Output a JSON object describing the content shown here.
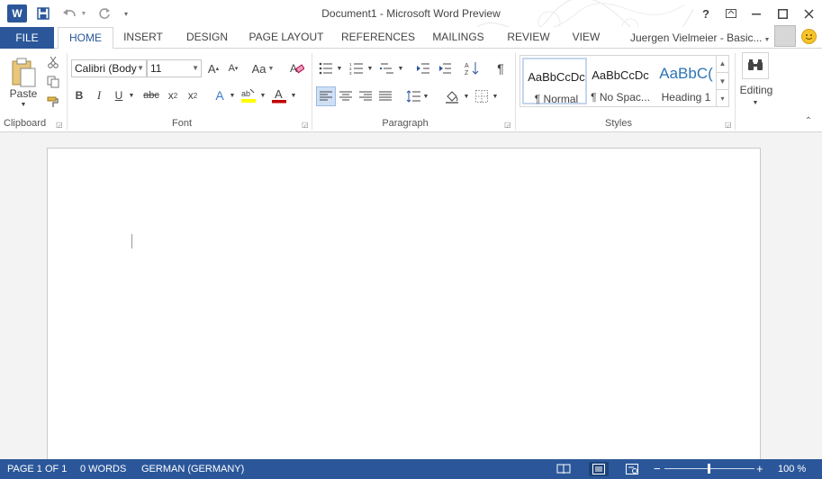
{
  "titlebar": {
    "app_logo": "W",
    "title": "Document1 - Microsoft Word Preview",
    "icons": [
      "word-logo-icon",
      "save-icon",
      "undo-icon",
      "redo-icon",
      "customize-quick-access-icon",
      "help-icon",
      "ribbon-display-icon",
      "minimize-icon",
      "maximize-icon",
      "close-icon"
    ]
  },
  "tabs": {
    "file": "FILE",
    "items": [
      "HOME",
      "INSERT",
      "DESIGN",
      "PAGE LAYOUT",
      "REFERENCES",
      "MAILINGS",
      "REVIEW",
      "VIEW"
    ],
    "active": "HOME",
    "user_name": "Juergen Vielmeier - Basic..."
  },
  "ribbon": {
    "clipboard": {
      "label": "Clipboard",
      "paste_label": "Paste"
    },
    "font": {
      "label": "Font",
      "font_name": "Calibri (Body",
      "font_size": "11",
      "change_case": "Aa"
    },
    "paragraph": {
      "label": "Paragraph"
    },
    "styles": {
      "label": "Styles",
      "items": [
        {
          "sample": "AaBbCcDc",
          "name": "¶ Normal"
        },
        {
          "sample": "AaBbCcDc",
          "name": "¶ No Spac..."
        },
        {
          "sample": "AaBbC(",
          "name": "Heading 1"
        }
      ]
    },
    "editing": {
      "label": "Editing"
    }
  },
  "statusbar": {
    "page": "PAGE 1 OF 1",
    "words": "0 WORDS",
    "language": "GERMAN (GERMANY)",
    "zoom": "100 %",
    "zoom_percent": 100
  },
  "colors": {
    "accent": "#2b579a",
    "highlight": "#ffff00",
    "font_color": "#c00000"
  }
}
